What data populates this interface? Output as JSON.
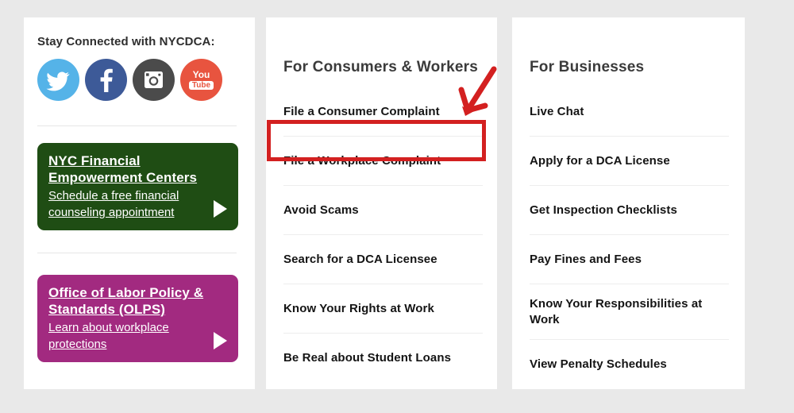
{
  "page": {
    "background_color": "#e9e9e9",
    "card_background": "#ffffff"
  },
  "social_card": {
    "heading": "Stay Connected with NYCDCA:",
    "icons": [
      {
        "name": "twitter-icon",
        "label": "Twitter",
        "color": "#55b3e8"
      },
      {
        "name": "facebook-icon",
        "label": "Facebook",
        "color": "#3d5a98"
      },
      {
        "name": "instagram-icon",
        "label": "Instagram",
        "color": "#4b4b4b"
      },
      {
        "name": "youtube-icon",
        "label": "YouTube",
        "color": "#e8543f",
        "text_top": "You",
        "text_bottom": "Tube"
      }
    ],
    "promos": [
      {
        "title_line_1": "NYC Financial",
        "title_line_2": "Empowerment Centers",
        "subtitle": "Schedule a free financial counseling appointment",
        "color": "#1f4d14",
        "arrow": "play-arrow-icon"
      },
      {
        "title_line_1": "Office of Labor Policy &",
        "title_line_2": "Standards (OLPS)",
        "subtitle": "Learn about workplace protections",
        "color": "#a22a80",
        "arrow": "play-arrow-icon"
      }
    ]
  },
  "consumer_card": {
    "heading": "For Consumers & Workers",
    "links": [
      "File a Consumer Complaint",
      "File a Workplace Complaint",
      "Avoid Scams",
      "Search for a DCA Licensee",
      "Know Your Rights at Work",
      "Be Real about Student Loans"
    ]
  },
  "business_card": {
    "heading": "For Businesses",
    "links": [
      "Live Chat",
      "Apply for a DCA License",
      "Get Inspection Checklists",
      "Pay Fines and Fees",
      "Know Your Responsibilities at Work",
      "View Penalty Schedules"
    ]
  },
  "annotation": {
    "highlight_color": "#d32020",
    "highlight_target": "File a Workplace Complaint",
    "arrow_direction": "down-left"
  }
}
